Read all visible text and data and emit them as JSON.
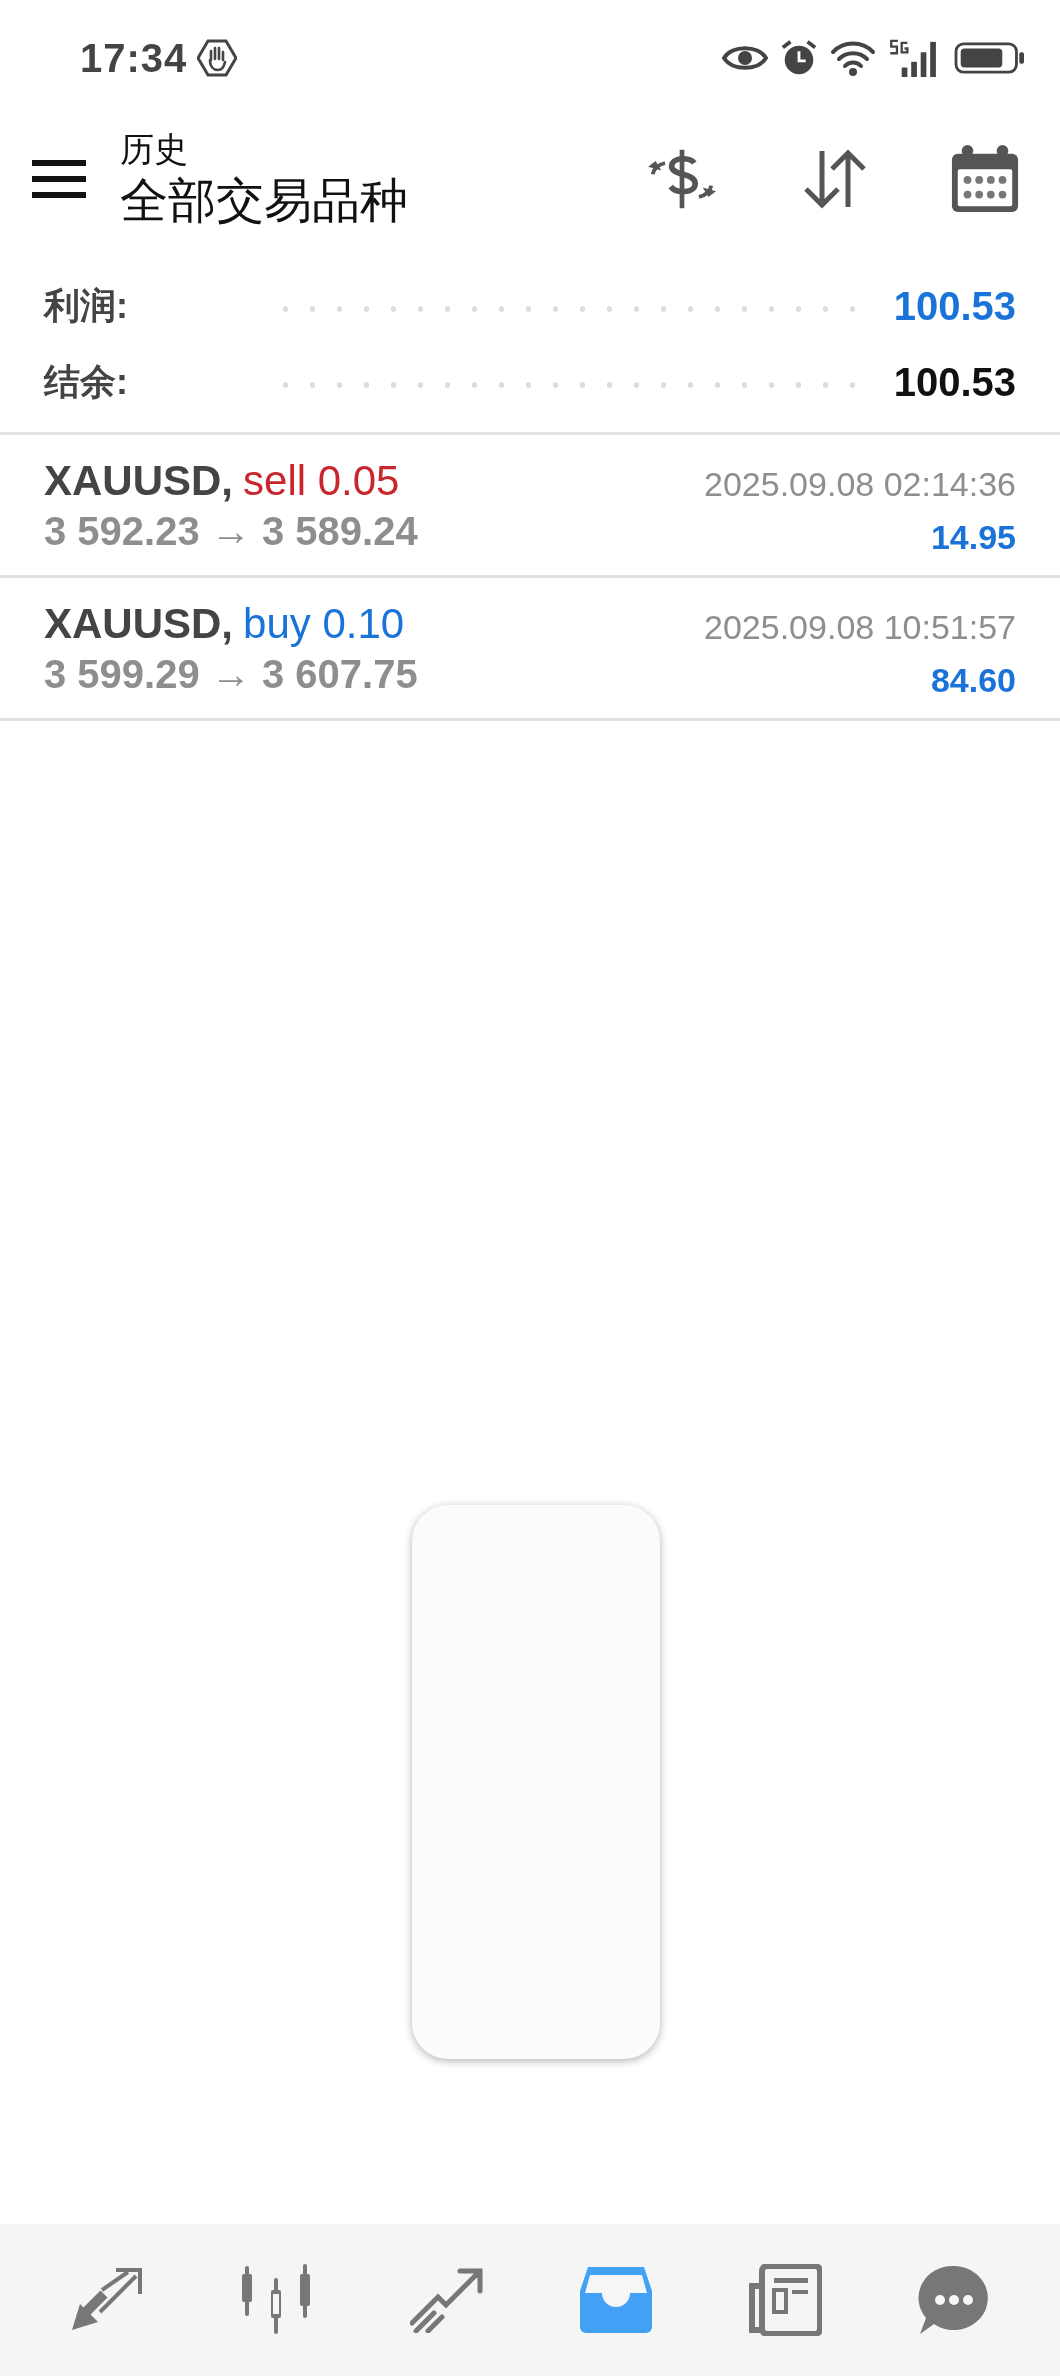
{
  "status_bar": {
    "time": "17:34"
  },
  "header": {
    "title": "历史",
    "subtitle": "全部交易品种"
  },
  "summary": [
    {
      "label": "利润:",
      "value": "100.53",
      "kind": "profit"
    },
    {
      "label": "结余:",
      "value": "100.53",
      "kind": "balance"
    }
  ],
  "deals": [
    {
      "symbol": "XAUUSD,",
      "side": "sell 0.05",
      "kind": "sell",
      "prices": "3 592.23 → 3 589.24",
      "time": "2025.09.08 02:14:36",
      "profit": "14.95"
    },
    {
      "symbol": "XAUUSD,",
      "side": "buy 0.10",
      "kind": "buy",
      "prices": "3 599.29 → 3 607.75",
      "time": "2025.09.08 10:51:57",
      "profit": "84.60"
    }
  ],
  "nav": [
    {
      "kind": "trade",
      "selected": false
    },
    {
      "kind": "chart",
      "selected": false
    },
    {
      "kind": "history",
      "selected": false
    },
    {
      "kind": "inbox",
      "selected": true
    },
    {
      "kind": "news",
      "selected": false
    },
    {
      "kind": "chat",
      "selected": false
    }
  ]
}
